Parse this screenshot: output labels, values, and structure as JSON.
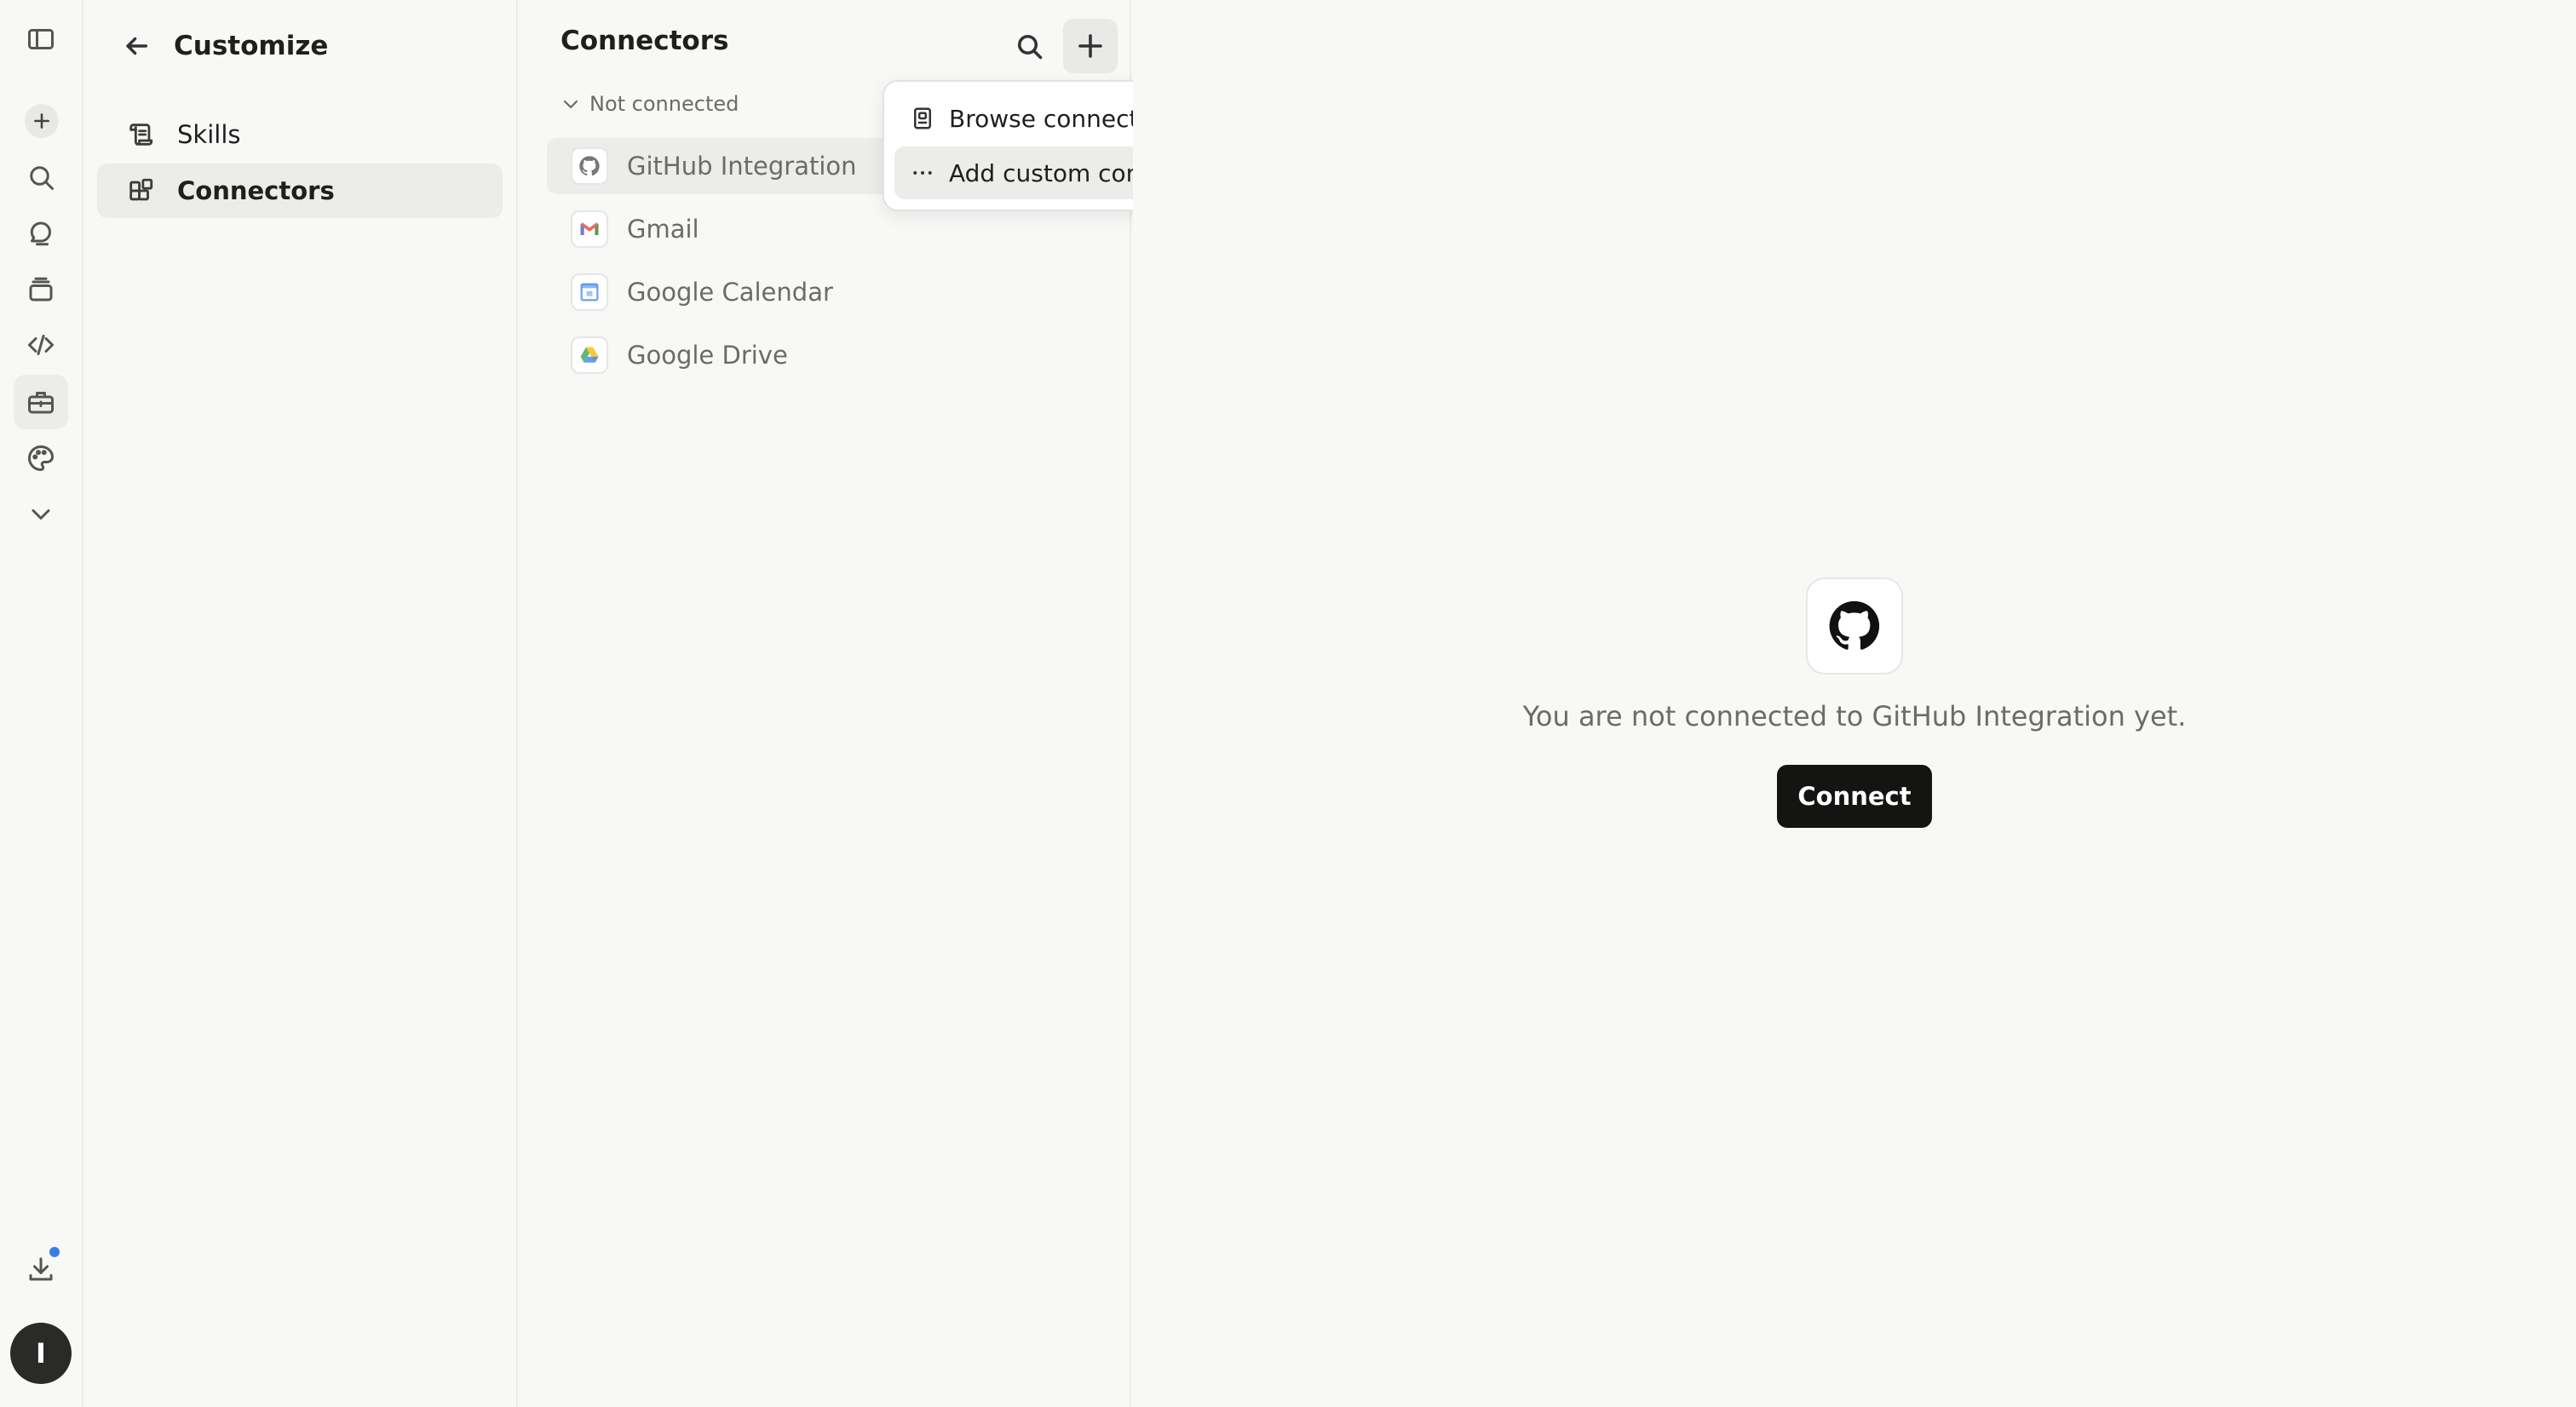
{
  "rail": {
    "avatar_initial": "I",
    "icons": [
      "sidebar-toggle-icon",
      "new-chat-icon",
      "search-icon",
      "chats-icon",
      "projects-icon",
      "code-icon",
      "toolbox-icon",
      "palette-icon",
      "chevron-down-icon",
      "download-icon"
    ]
  },
  "customize": {
    "title": "Customize",
    "nav": [
      {
        "label": "Skills",
        "icon": "scroll-icon"
      },
      {
        "label": "Connectors",
        "icon": "connectors-icon"
      }
    ]
  },
  "connectors": {
    "title": "Connectors",
    "section_label": "Not connected",
    "items": [
      {
        "label": "GitHub Integration",
        "icon": "github-icon"
      },
      {
        "label": "Gmail",
        "icon": "gmail-icon"
      },
      {
        "label": "Google Calendar",
        "icon": "google-calendar-icon"
      },
      {
        "label": "Google Drive",
        "icon": "google-drive-icon"
      }
    ]
  },
  "dropdown": {
    "items": [
      {
        "label": "Browse connectors",
        "icon": "browse-icon"
      },
      {
        "label": "Add custom connector",
        "icon": "more-icon"
      }
    ]
  },
  "main": {
    "empty_message": "You are not connected to GitHub Integration yet.",
    "connect_label": "Connect"
  },
  "colors": {
    "background": "#f8f8f7",
    "active_bg": "#ececea",
    "primary_button": "#141413",
    "notification_dot": "#3b7be8"
  }
}
